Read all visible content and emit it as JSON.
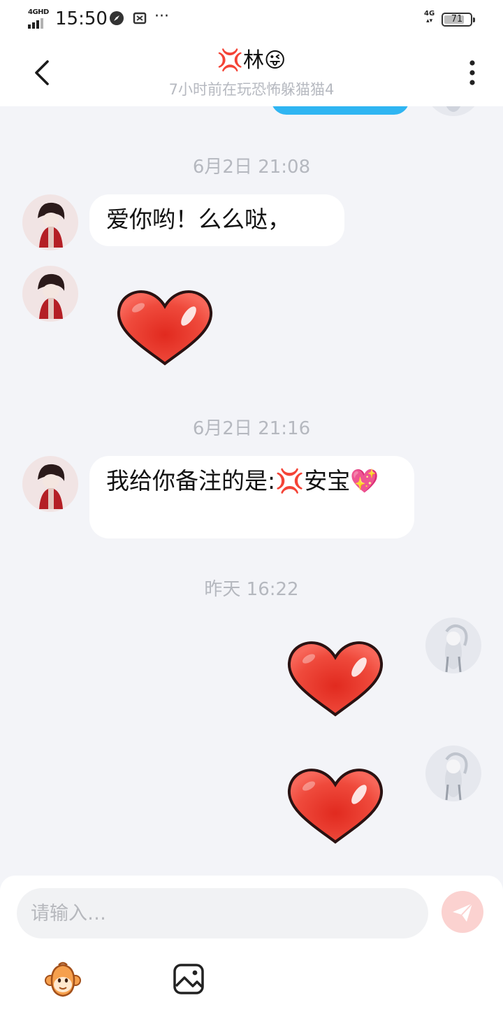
{
  "status_bar": {
    "network": "4GHD",
    "time": "15:50",
    "data_label": "4G",
    "battery": "71"
  },
  "header": {
    "title": "💢林😜",
    "subtitle": "7小时前在玩恐怖躲猫猫4"
  },
  "messages": [
    {
      "type": "timestamp",
      "text": "6月2日 21:08"
    },
    {
      "type": "text",
      "side": "left",
      "text": "爱你哟！么么哒，"
    },
    {
      "type": "heart",
      "side": "left"
    },
    {
      "type": "timestamp",
      "text": "6月2日 21:16"
    },
    {
      "type": "text",
      "side": "left",
      "text": "我给你备注的是:💢安宝💖"
    },
    {
      "type": "timestamp",
      "text": "昨天 16:22"
    },
    {
      "type": "heart",
      "side": "right"
    },
    {
      "type": "heart",
      "side": "right"
    }
  ],
  "composer": {
    "placeholder": "请输入…"
  },
  "icons": {
    "back": "chevron-left-icon",
    "more": "more-vertical-icon",
    "send": "send-icon",
    "sticker": "monkey-sticker-icon",
    "image": "image-icon"
  },
  "colors": {
    "accent_blue": "#2fb5f2",
    "heart_red": "#e9352e",
    "send_disabled": "#fbd2d0",
    "chat_background": "#f3f4f8"
  }
}
